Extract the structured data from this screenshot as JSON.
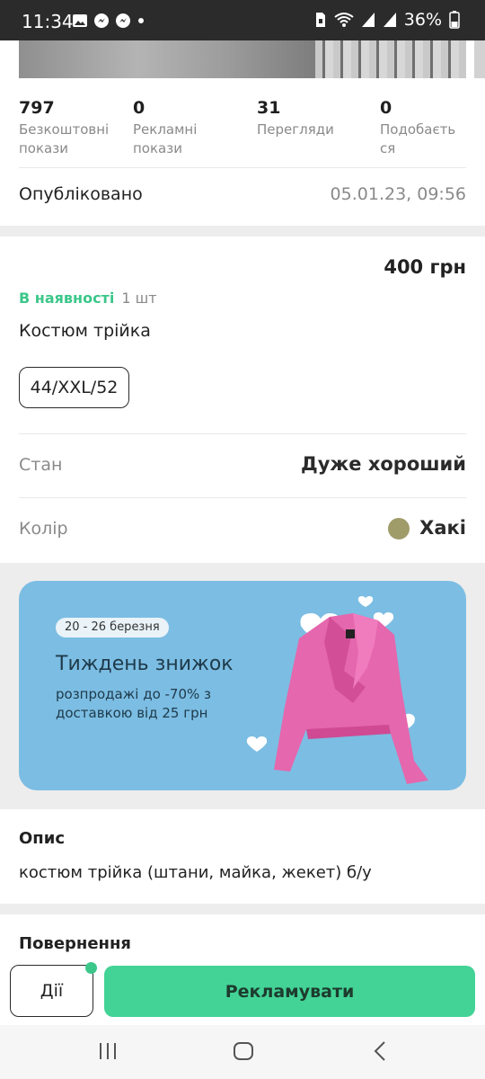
{
  "status_bar": {
    "time": "11:34",
    "battery": "36%",
    "icons_left": [
      "gallery-icon",
      "messenger-icon",
      "messenger-icon",
      "dot-icon"
    ],
    "icons_right": [
      "sim-icon",
      "wifi-icon",
      "signal-icon",
      "signal-icon",
      "battery-icon"
    ]
  },
  "stats": [
    {
      "value": "797",
      "label_line1": "Безкоштовні",
      "label_line2": "покази"
    },
    {
      "value": "0",
      "label_line1": "Рекламні",
      "label_line2": "покази"
    },
    {
      "value": "31",
      "label_line1": "Перегляди",
      "label_line2": ""
    },
    {
      "value": "0",
      "label_line1": "Подобаєть",
      "label_line2": "ся"
    }
  ],
  "published": {
    "label": "Опубліковано",
    "date": "05.01.23, 09:56"
  },
  "listing": {
    "price": "400 грн",
    "availability": "В наявності",
    "quantity": "1 шт",
    "title": "Костюм трійка",
    "size": "44/XXL/52"
  },
  "attributes": {
    "condition_label": "Стан",
    "condition_value": "Дуже хороший",
    "color_label": "Колір",
    "color_value": "Хакі",
    "color_hex": "#a09c6a"
  },
  "banner": {
    "dates": "20 - 26 березня",
    "title": "Тиждень знижок",
    "subtitle_line1": "розпродажі до -70% з",
    "subtitle_line2": "доставкою від 25 грн"
  },
  "description": {
    "title": "Опис",
    "text": "костюм трійка (штани, майка, жекет) б/у"
  },
  "returns": {
    "title": "Повернення"
  },
  "actions": {
    "actions_label": "Дії",
    "promote_label": "Рекламувати"
  },
  "colors": {
    "accent_green": "#43d396",
    "availability_green": "#3cc78a",
    "banner_blue": "#7cbde3"
  }
}
